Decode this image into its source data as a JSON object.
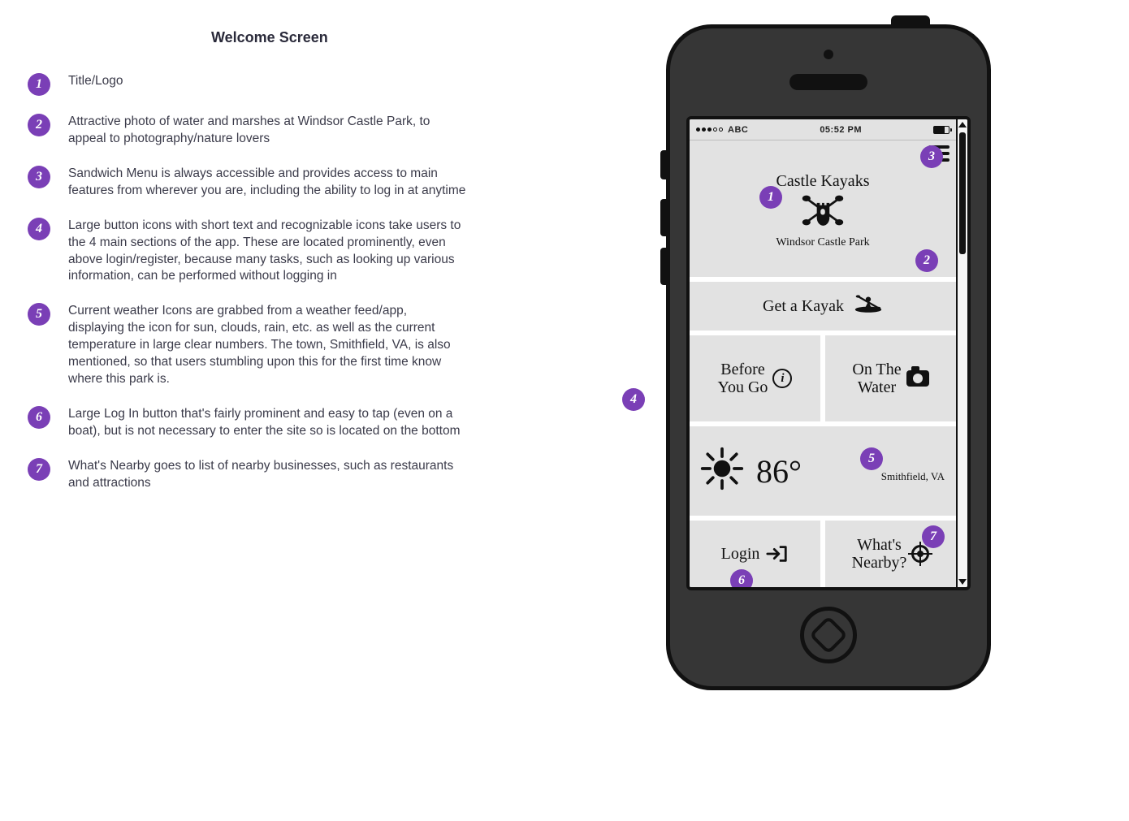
{
  "page_title": "Welcome Screen",
  "notes": [
    {
      "num": "1",
      "text": "Title/Logo"
    },
    {
      "num": "2",
      "text": "Attractive photo of water and marshes at Windsor Castle Park, to appeal to photography/nature lovers"
    },
    {
      "num": "3",
      "text": "Sandwich Menu is always accessible and provides access to main features from wherever you are, including the ability to log in at anytime"
    },
    {
      "num": "4",
      "text": "Large button icons with short text and recognizable icons take users to the 4 main sections of the app. These are located prominently, even above login/register, because many tasks, such as looking up various information, can be performed without logging in"
    },
    {
      "num": "5",
      "text": "Current weather Icons are grabbed from a weather feed/app, displaying the icon for sun, clouds, rain, etc. as well as the current temperature in large clear numbers. The town, Smithfield, VA, is also mentioned, so that users stumbling upon this for the first time know where this park is."
    },
    {
      "num": "6",
      "text": "Large Log In button that's fairly prominent and easy to tap (even on a boat), but is not necessary to enter the site so is located on the bottom"
    },
    {
      "num": "7",
      "text": "What's Nearby goes to list of nearby businesses, such as restaurants and attractions"
    }
  ],
  "status_bar": {
    "carrier": "ABC",
    "time": "05:52 PM"
  },
  "hero": {
    "title": "Castle Kayaks",
    "subtitle": "Windsor Castle Park"
  },
  "tiles": {
    "get_kayak": "Get a Kayak",
    "before_line1": "Before",
    "before_line2": "You Go",
    "water_line1": "On The",
    "water_line2": "Water",
    "login": "Login",
    "nearby_line1": "What's",
    "nearby_line2": "Nearby?"
  },
  "weather": {
    "temp": "86°",
    "location": "Smithfield, VA"
  },
  "callouts": {
    "c1": "1",
    "c2": "2",
    "c3": "3",
    "c4": "4",
    "c5": "5",
    "c6": "6",
    "c7": "7"
  }
}
